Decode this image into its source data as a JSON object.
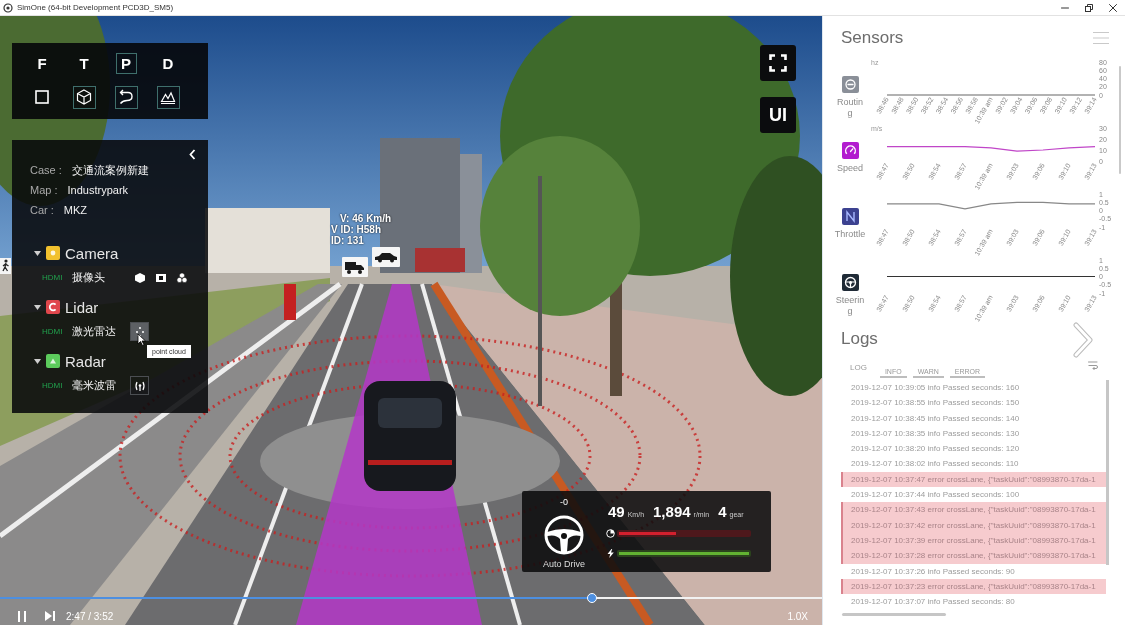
{
  "window": {
    "title": "SimOne (64-bit Development PCD3D_SM5)"
  },
  "view_modes": [
    {
      "label": "F",
      "selected": false
    },
    {
      "label": "T",
      "selected": false
    },
    {
      "label": "P",
      "selected": true
    },
    {
      "label": "D",
      "selected": false
    }
  ],
  "view_toggles": [
    {
      "selected": false
    },
    {
      "selected": true
    },
    {
      "selected": true
    },
    {
      "selected": true
    }
  ],
  "scenario": {
    "fields": [
      {
        "label": "Case :",
        "value": "交通流案例新建"
      },
      {
        "label": "Map :",
        "value": "Industrypark"
      },
      {
        "label": "Car :",
        "value": "MKZ"
      }
    ]
  },
  "sensors": [
    {
      "name": "Camera",
      "color": "#f2c12e",
      "expanded": true,
      "port": "HDMI",
      "device": "摄像头",
      "actions": [
        {
          "on": false,
          "hovered": false
        },
        {
          "on": false,
          "hovered": false
        },
        {
          "on": false,
          "hovered": false
        }
      ]
    },
    {
      "name": "Lidar",
      "color": "#e0474c",
      "expanded": true,
      "port": "HDMI",
      "device": "激光雷达",
      "actions": [
        {
          "on": true,
          "hovered": true,
          "tooltip": "point cloud"
        }
      ]
    },
    {
      "name": "Radar",
      "color": "#5ccc5c",
      "expanded": true,
      "port": "HDMI",
      "device": "毫米波雷",
      "actions": [
        {
          "on": true,
          "hovered": false
        }
      ]
    }
  ],
  "ui_button": {
    "label": "UI"
  },
  "vehicle_label": {
    "lines": [
      "V: 46 Km/h",
      "V ID: H58h",
      "ID: 131"
    ]
  },
  "dashboard": {
    "steering_angle": "-0",
    "mode": "Auto Drive",
    "readouts": [
      {
        "value": "49",
        "unit": "Km/h"
      },
      {
        "value": "1,894",
        "unit": "r/min"
      },
      {
        "value": "4",
        "unit": "gear"
      }
    ],
    "bars": [
      {
        "level": 0.44,
        "color": "#d4202e"
      },
      {
        "level": 1,
        "color": "#62b232"
      }
    ]
  },
  "playback": {
    "level": 0.72,
    "playing": true,
    "time": "2:47 / 3:52",
    "speed": "1.0X"
  },
  "sensor_panel": {
    "title": "Sensors",
    "charts": [
      {
        "name": "Routing",
        "color": "#8a8f98",
        "chart_data": {
          "type": "line",
          "ylabel": "hz",
          "categories": [
            "38:46",
            "38:48",
            "38:50",
            "38:52",
            "38:54",
            "38:56",
            "38:58",
            "10:39 am",
            "39:02",
            "39:04",
            "39:06",
            "39:08",
            "39:10",
            "39:12",
            "39:14"
          ],
          "series": [
            {
              "color": "#666666",
              "values": [
                0,
                0,
                0,
                0,
                0,
                0,
                0,
                0,
                0,
                0,
                0,
                0,
                0,
                0,
                0
              ]
            }
          ],
          "ylim": [
            0,
            80
          ],
          "yticks": [
            0,
            20,
            40,
            60,
            80
          ]
        }
      },
      {
        "name": "Speed",
        "color": "#b21ccf",
        "chart_data": {
          "type": "line",
          "ylabel": "m/s",
          "categories": [
            "38:47",
            "38:50",
            "38:54",
            "38:57",
            "10:39 am",
            "39:03",
            "39:06",
            "39:10",
            "39:13"
          ],
          "series": [
            {
              "color": "#c046c8",
              "values": [
                13,
                13,
                13,
                13,
                12,
                9,
                10,
                12,
                13
              ]
            }
          ],
          "ylim": [
            0,
            30
          ],
          "yticks": [
            0,
            10,
            20,
            30
          ]
        }
      },
      {
        "name": "Throttle",
        "color": "#3c4290",
        "chart_data": {
          "type": "line",
          "categories": [
            "38:47",
            "38:50",
            "38:54",
            "38:57",
            "10:39 am",
            "39:03",
            "39:06",
            "39:10",
            "39:13"
          ],
          "series": [
            {
              "color": "#888888",
              "values": [
                0.4,
                0.4,
                0.4,
                0.1,
                0.4,
                0.5,
                0.5,
                0.4,
                0.4
              ]
            }
          ],
          "ylim": [
            -1,
            1
          ],
          "yticks": [
            -1,
            -0.5,
            0,
            0.5,
            1
          ]
        }
      },
      {
        "name": "Steering",
        "color": "#1f2a36",
        "chart_data": {
          "type": "line",
          "categories": [
            "38:47",
            "38:50",
            "38:54",
            "38:57",
            "10:39 am",
            "39:03",
            "39:06",
            "39:10",
            "39:13"
          ],
          "series": [
            {
              "color": "#333333",
              "values": [
                0,
                0,
                0,
                0,
                0,
                0,
                0,
                0,
                0
              ]
            }
          ],
          "ylim": [
            -1,
            1
          ],
          "yticks": [
            -1,
            -0.5,
            0,
            0.5,
            1
          ]
        }
      }
    ]
  },
  "logs": {
    "title": "Logs",
    "label": "LOG",
    "filters": [
      "INFO",
      "WARN",
      "ERROR"
    ],
    "rows": [
      {
        "kind": "info",
        "text": "2019-12-07 10:39:05 info Passed seconds: 160"
      },
      {
        "kind": "info",
        "text": "2019-12-07 10:38:55 info Passed seconds: 150"
      },
      {
        "kind": "info",
        "text": "2019-12-07 10:38:45 info Passed seconds: 140"
      },
      {
        "kind": "info",
        "text": "2019-12-07 10:38:35 info Passed seconds: 130"
      },
      {
        "kind": "info",
        "text": "2019-12-07 10:38:20 info Passed seconds: 120"
      },
      {
        "kind": "info",
        "text": "2019-12-07 10:38:02 info Passed seconds: 110"
      },
      {
        "kind": "error",
        "text": "2019-12-07 10:37:47 error crossLane, {\"taskUuid\":\"08993870-17da-1"
      },
      {
        "kind": "info",
        "text": "2019-12-07 10:37:44 info Passed seconds: 100"
      },
      {
        "kind": "error",
        "text": "2019-12-07 10:37:43 error crossLane, {\"taskUuid\":\"08993870-17da-1"
      },
      {
        "kind": "error",
        "text": "2019-12-07 10:37:42 error crossLane, {\"taskUuid\":\"08993870-17da-1"
      },
      {
        "kind": "error",
        "text": "2019-12-07 10:37:39 error crossLane, {\"taskUuid\":\"08993870-17da-1"
      },
      {
        "kind": "error",
        "text": "2019-12-07 10:37:28 error crossLane, {\"taskUuid\":\"08993870-17da-1"
      },
      {
        "kind": "info",
        "text": "2019-12-07 10:37:26 info Passed seconds: 90"
      },
      {
        "kind": "error",
        "text": "2019-12-07 10:37:23 error crossLane, {\"taskUuid\":\"08993870-17da-1"
      },
      {
        "kind": "info",
        "text": "2019-12-07 10:37:07 info Passed seconds: 80"
      }
    ]
  }
}
